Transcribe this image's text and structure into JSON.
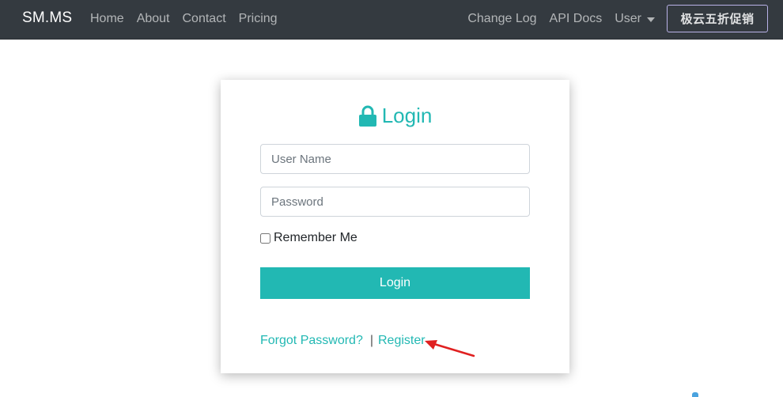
{
  "navbar": {
    "brand": "SM.MS",
    "left_links": [
      "Home",
      "About",
      "Contact",
      "Pricing"
    ],
    "right_links": [
      "Change Log",
      "API Docs"
    ],
    "user_label": "User",
    "promo_label": "极云五折促销"
  },
  "login": {
    "title": "Login",
    "username_placeholder": "User Name",
    "password_placeholder": "Password",
    "remember_label": "Remember Me",
    "remember_checked": false,
    "submit_label": "Login",
    "forgot_label": "Forgot Password?",
    "separator": "|",
    "register_label": "Register"
  },
  "colors": {
    "navbar_bg": "#343a40",
    "accent": "#22b8b3",
    "annotation_arrow": "#e02020"
  },
  "icons": {
    "title_icon": "lock-icon",
    "annotation": "red-arrow-icon"
  }
}
